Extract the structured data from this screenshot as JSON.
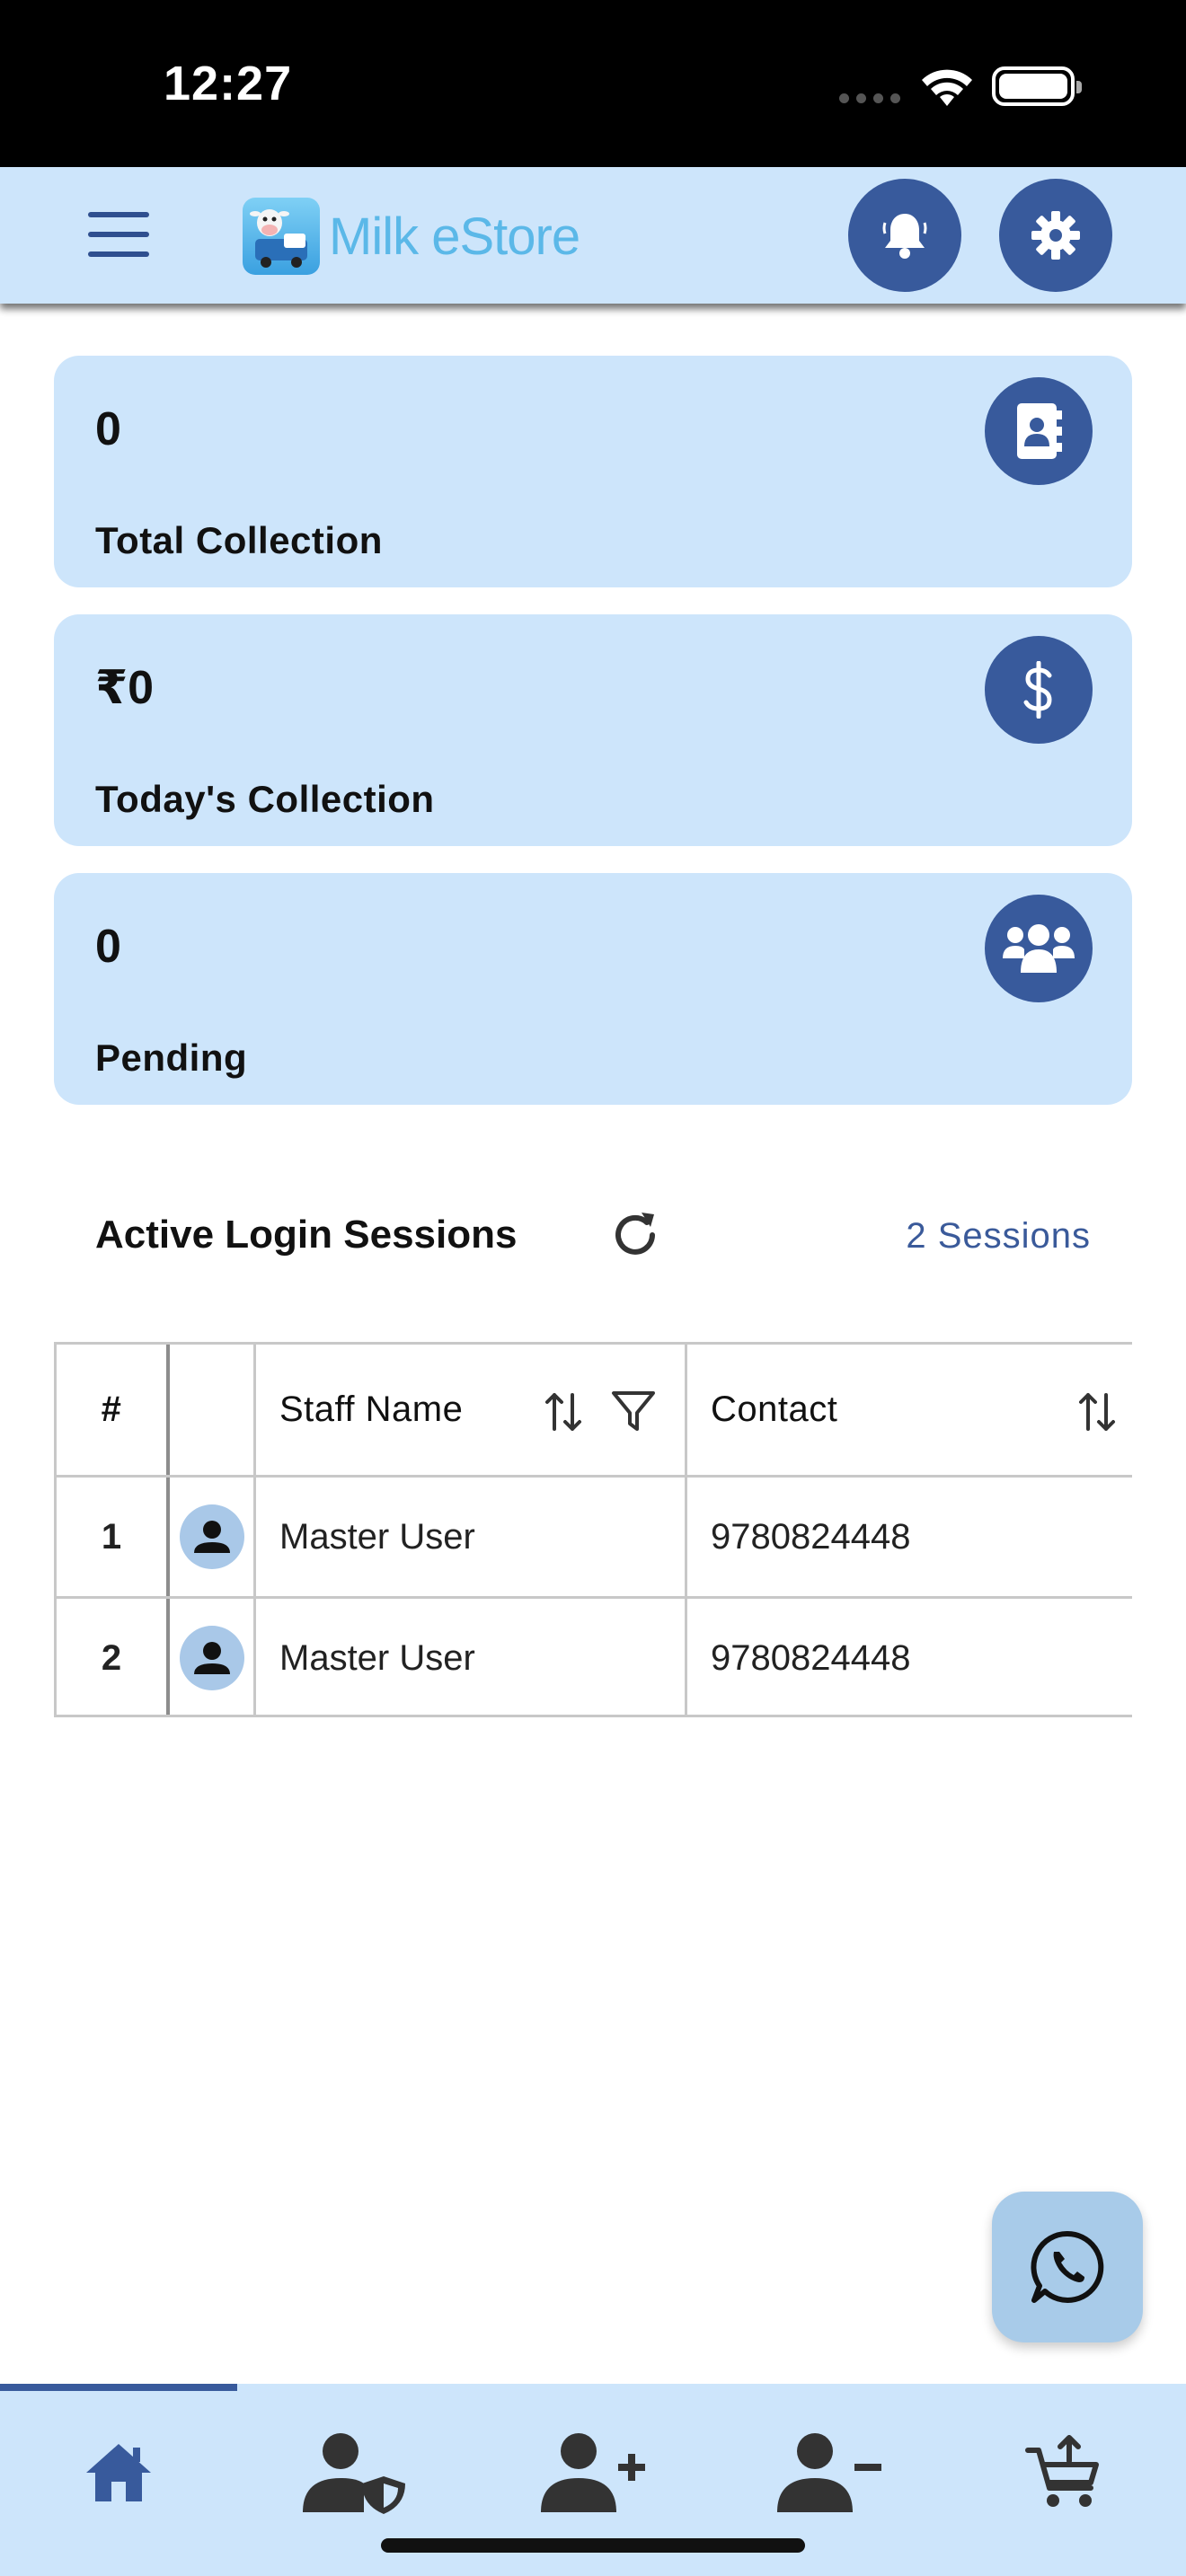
{
  "status_bar": {
    "time": "12:27"
  },
  "app_bar": {
    "app_name": "Milk eStore"
  },
  "stats": [
    {
      "value": "0",
      "label": "Total Collection",
      "icon": "contact-book-icon"
    },
    {
      "value": "₹0",
      "label": "Today's Collection",
      "icon": "dollar-icon"
    },
    {
      "value": "0",
      "label": "Pending",
      "icon": "users-group-icon"
    }
  ],
  "sessions": {
    "title": "Active Login Sessions",
    "count_label": "2 Sessions",
    "columns": {
      "num": "#",
      "avatar": "",
      "name": "Staff Name",
      "contact": "Contact"
    },
    "rows": [
      {
        "num": "1",
        "name": "Master User",
        "contact": "9780824448"
      },
      {
        "num": "2",
        "name": "Master User",
        "contact": "9780824448"
      }
    ]
  },
  "bottom_nav": {
    "items": [
      "home-icon",
      "user-shield-icon",
      "user-plus-icon",
      "user-minus-icon",
      "cart-upload-icon"
    ],
    "active_index": 0
  },
  "colors": {
    "primary": "#385a9c",
    "surface": "#cde5fb",
    "accent_text": "#3a5a9a"
  }
}
